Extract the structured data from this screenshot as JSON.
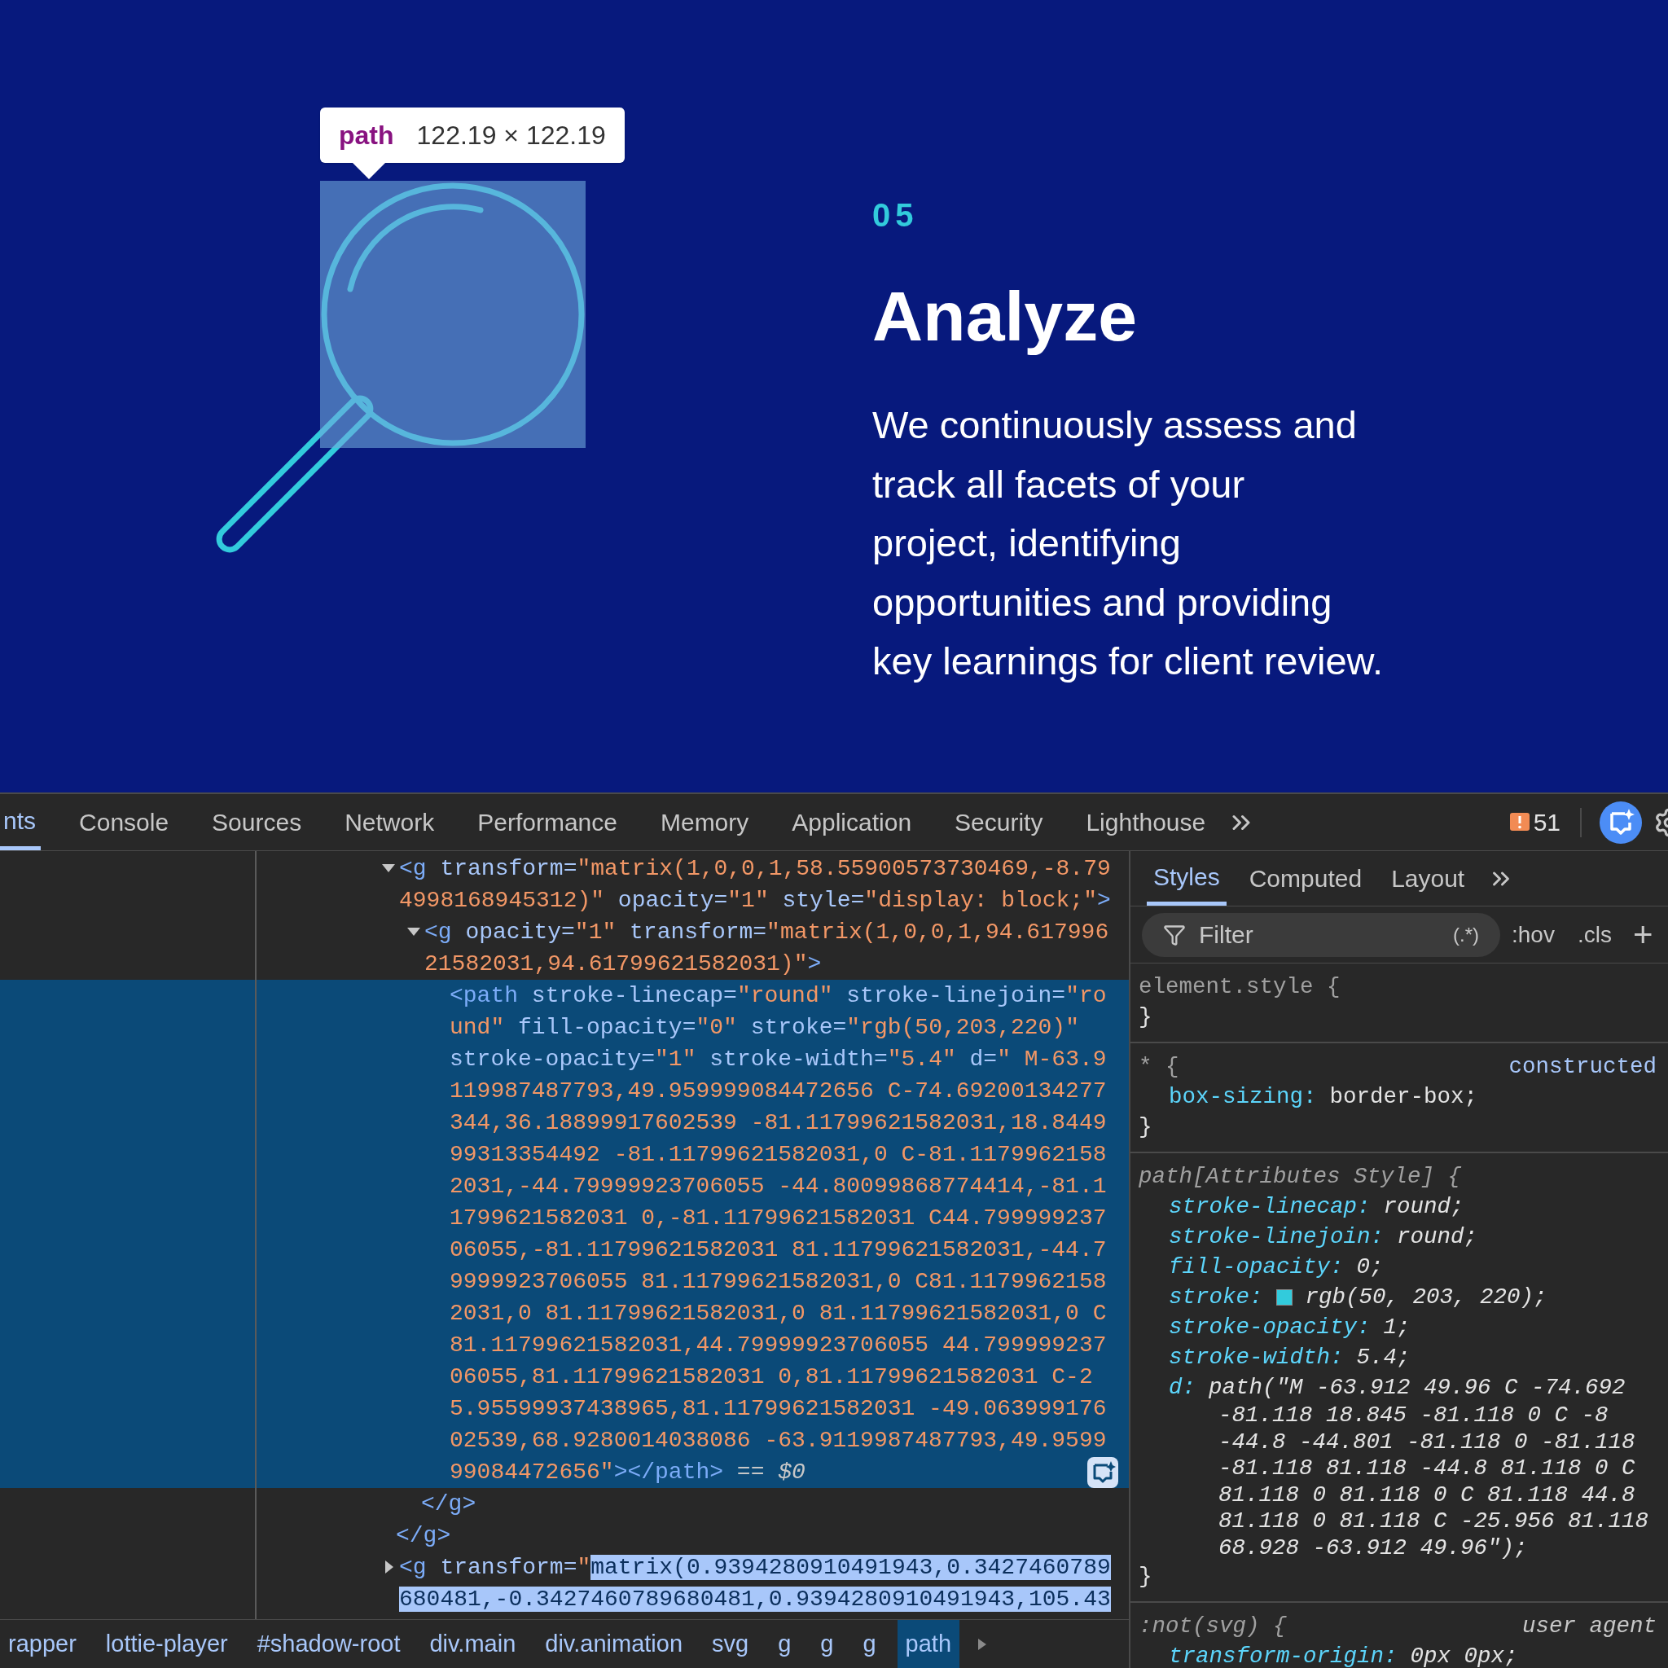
{
  "page": {
    "step": "05",
    "title": "Analyze",
    "description_lines": [
      "We continuously assess and",
      "track all facets of your",
      "project, identifying",
      "opportunities and providing",
      "key learnings for client review."
    ]
  },
  "inspect_tooltip": {
    "tag": "path",
    "size": "122.19 × 122.19"
  },
  "devtools": {
    "tabs": [
      {
        "label": "nts",
        "selected": true
      },
      {
        "label": "Console",
        "selected": false
      },
      {
        "label": "Sources",
        "selected": false
      },
      {
        "label": "Network",
        "selected": false
      },
      {
        "label": "Performance",
        "selected": false
      },
      {
        "label": "Memory",
        "selected": false
      },
      {
        "label": "Application",
        "selected": false
      },
      {
        "label": "Security",
        "selected": false
      },
      {
        "label": "Lighthouse",
        "selected": false
      }
    ],
    "issues_count": "51",
    "elements": {
      "nodes": [
        {
          "expanded": true,
          "selected": false,
          "lines": [
            [
              {
                "kind": "tag",
                "text": "<g "
              },
              {
                "kind": "attr",
                "text": "transform="
              },
              {
                "kind": "value",
                "text": "\"matrix(1,0,0,1,58.55900573730469,-8.79"
              }
            ],
            [
              {
                "kind": "value",
                "text": "4998168945312)\""
              },
              {
                "kind": "attr",
                "text": " opacity="
              },
              {
                "kind": "value",
                "text": "\"1\""
              },
              {
                "kind": "attr",
                "text": " style="
              },
              {
                "kind": "value",
                "text": "\"display: block;\""
              },
              {
                "kind": "tag",
                "text": ">"
              }
            ]
          ],
          "children": [
            {
              "expanded": true,
              "selected": false,
              "lines": [
                [
                  {
                    "kind": "tag",
                    "text": "<g "
                  },
                  {
                    "kind": "attr",
                    "text": "opacity="
                  },
                  {
                    "kind": "value",
                    "text": "\"1\""
                  },
                  {
                    "kind": "attr",
                    "text": " transform="
                  },
                  {
                    "kind": "value",
                    "text": "\"matrix(1,0,0,1,94.617996"
                  }
                ],
                [
                  {
                    "kind": "value",
                    "text": "21582031,94.61799621582031)\""
                  },
                  {
                    "kind": "tag",
                    "text": ">"
                  }
                ]
              ],
              "children": [
                {
                  "selected": true,
                  "lines": [
                    [
                      {
                        "kind": "tag",
                        "text": "<path "
                      },
                      {
                        "kind": "attr",
                        "text": "stroke-linecap="
                      },
                      {
                        "kind": "value",
                        "text": "\"round\""
                      },
                      {
                        "kind": "attr",
                        "text": " stroke-linejoin="
                      },
                      {
                        "kind": "value",
                        "text": "\"ro"
                      }
                    ],
                    [
                      {
                        "kind": "value",
                        "text": "und\""
                      },
                      {
                        "kind": "attr",
                        "text": " fill-opacity="
                      },
                      {
                        "kind": "value",
                        "text": "\"0\""
                      },
                      {
                        "kind": "attr",
                        "text": " stroke="
                      },
                      {
                        "kind": "value",
                        "text": "\"rgb(50,203,220)\""
                      }
                    ],
                    [
                      {
                        "kind": "attr",
                        "text": "stroke-opacity="
                      },
                      {
                        "kind": "value",
                        "text": "\"1\""
                      },
                      {
                        "kind": "attr",
                        "text": " stroke-width="
                      },
                      {
                        "kind": "value",
                        "text": "\"5.4\""
                      },
                      {
                        "kind": "attr",
                        "text": " d="
                      },
                      {
                        "kind": "value",
                        "text": "\" M-63.9"
                      }
                    ],
                    [
                      {
                        "kind": "value",
                        "text": "119987487793,49.959999084472656 C-74.69200134277"
                      }
                    ],
                    [
                      {
                        "kind": "value",
                        "text": "344,36.18899917602539 -81.11799621582031,18.8449"
                      }
                    ],
                    [
                      {
                        "kind": "value",
                        "text": "99313354492 -81.11799621582031,0 C-81.1179962158"
                      }
                    ],
                    [
                      {
                        "kind": "value",
                        "text": "2031,-44.79999923706055 -44.80099868774414,-81.1"
                      }
                    ],
                    [
                      {
                        "kind": "value",
                        "text": "1799621582031 0,-81.11799621582031 C44.799999237"
                      }
                    ],
                    [
                      {
                        "kind": "value",
                        "text": "06055,-81.11799621582031 81.11799621582031,-44.7"
                      }
                    ],
                    [
                      {
                        "kind": "value",
                        "text": "9999923706055 81.11799621582031,0 C81.1179962158"
                      }
                    ],
                    [
                      {
                        "kind": "value",
                        "text": "2031,0 81.11799621582031,0 81.11799621582031,0 C"
                      }
                    ],
                    [
                      {
                        "kind": "value",
                        "text": "81.11799621582031,44.79999923706055 44.799999237"
                      }
                    ],
                    [
                      {
                        "kind": "value",
                        "text": "06055,81.11799621582031 0,81.11799621582031 C-2"
                      }
                    ],
                    [
                      {
                        "kind": "value",
                        "text": "5.95599937438965,81.11799621582031 -49.063999176"
                      }
                    ],
                    [
                      {
                        "kind": "value",
                        "text": "02539,68.9280014038086 -63.9119987487793,49.9599"
                      }
                    ],
                    [
                      {
                        "kind": "value",
                        "text": "99084472656\""
                      },
                      {
                        "kind": "tag",
                        "text": "></path>"
                      },
                      {
                        "kind": "plain",
                        "text": " == "
                      },
                      {
                        "kind": "var",
                        "text": "$0"
                      }
                    ]
                  ]
                }
              ],
              "closing": [
                {
                  "kind": "tag",
                  "text": "</g>"
                }
              ]
            }
          ],
          "closing": [
            {
              "kind": "tag",
              "text": "</g>"
            }
          ]
        },
        {
          "expanded": false,
          "selected": false,
          "lines": [
            [
              {
                "kind": "tag",
                "text": "<g "
              },
              {
                "kind": "attr",
                "text": "transform="
              },
              {
                "kind": "value",
                "text": "\""
              },
              {
                "kind": "highlight",
                "text": "matrix(0.9394280910491943,0.3427460789"
              }
            ],
            [
              {
                "kind": "highlight",
                "text": "680481,-0.3427460789680481,0.9394280910491943,105.43"
              }
            ]
          ]
        }
      ]
    },
    "breadcrumbs": [
      {
        "label": "rapper",
        "selected": false
      },
      {
        "label": "lottie-player",
        "selected": false
      },
      {
        "label": "#shadow-root",
        "selected": false
      },
      {
        "label": "div.main",
        "selected": false
      },
      {
        "label": "div.animation",
        "selected": false
      },
      {
        "label": "svg",
        "selected": false
      },
      {
        "label": "g",
        "selected": false
      },
      {
        "label": "g",
        "selected": false
      },
      {
        "label": "g",
        "selected": false
      },
      {
        "label": "path",
        "selected": true
      }
    ],
    "styles": {
      "tabs": [
        {
          "label": "Styles",
          "selected": true
        },
        {
          "label": "Computed",
          "selected": false
        },
        {
          "label": "Layout",
          "selected": false
        }
      ],
      "filter": {
        "placeholder": "Filter"
      },
      "regex_toggle": "(.*)",
      "hov": ":hov",
      "cls": ".cls",
      "add": "+",
      "rules": [
        {
          "selector": "element.style {",
          "italic": false,
          "close": "}"
        },
        {
          "selector": "* {",
          "italic": false,
          "origin": {
            "kind": "link",
            "text": "constructed"
          },
          "declarations": [
            {
              "property": "box-sizing:",
              "value": "border-box;"
            }
          ],
          "close": "}"
        },
        {
          "selector": "path[Attributes Style] {",
          "italic": true,
          "declarations": [
            {
              "property": "stroke-linecap:",
              "value": "round;"
            },
            {
              "property": "stroke-linejoin:",
              "value": "round;"
            },
            {
              "property": "fill-opacity:",
              "value": "0;"
            },
            {
              "property": "stroke:",
              "color": "#32cbdc",
              "value": "rgb(50, 203, 220);"
            },
            {
              "property": "stroke-opacity:",
              "value": "1;"
            },
            {
              "property": "stroke-width:",
              "value": "5.4;"
            },
            {
              "property": "d:",
              "value": "path(\"M -63.912 49.96 C -74.692",
              "value_lines": [
                "-81.118 18.845 -81.118 0 C -8",
                "-44.8 -44.801 -81.118 0 -81.118",
                "-81.118 81.118 -44.8 81.118 0 C",
                "81.118 0 81.118 0 C 81.118 44.8",
                "81.118 0 81.118 C -25.956 81.118",
                "68.928 -63.912 49.96\");"
              ]
            }
          ],
          "close": "}"
        },
        {
          "selector": ":not(svg) {",
          "italic": true,
          "origin": {
            "kind": "agent",
            "text": "user agent"
          },
          "declarations": [
            {
              "property": "transform-origin:",
              "value": "0px 0px;"
            }
          ]
        }
      ]
    }
  }
}
